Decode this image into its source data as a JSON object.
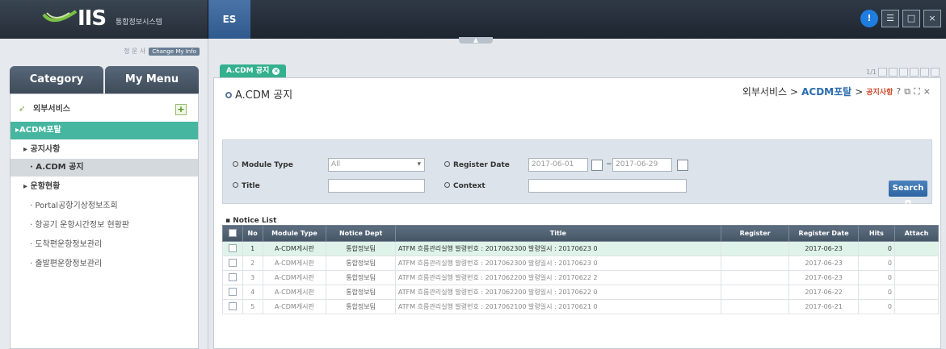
{
  "topbar": {
    "logo_text": "IIS",
    "logo_sub": "통합정보시스템",
    "system_tab": "ES",
    "icons": [
      "info-icon",
      "menu-icon",
      "window-icon",
      "close-icon"
    ]
  },
  "sidebar": {
    "user_text": "정 운 사",
    "change_info": "Change My Info",
    "tabs": [
      "Category",
      "My Menu"
    ],
    "root": "외부서비스",
    "items": [
      {
        "label": "ACDM포탈"
      },
      {
        "label": "공지사항"
      },
      {
        "label": "A.CDM 공지"
      },
      {
        "label": "운항현황"
      },
      {
        "label": "Portal공항기상정보조회"
      },
      {
        "label": "항공기 운항시간정보 현황판"
      },
      {
        "label": "도착편운항정보관리"
      },
      {
        "label": "출발편운항정보관리"
      }
    ]
  },
  "main": {
    "tab_label": "A.CDM 공지",
    "pager": "1/1",
    "title": "A.CDM 공지",
    "breadcrumb": {
      "c1": "외부서비스",
      "sep": ">",
      "c2": "ACDM포탈",
      "c3": "공지사항"
    },
    "search": {
      "module_type_label": "Module Type",
      "module_type_value": "All",
      "register_date_label": "Register Date",
      "date_from": "2017-06-01",
      "date_sep": "~",
      "date_to": "2017-06-29",
      "title_label": "Title",
      "context_label": "Context",
      "search_button": "Search"
    },
    "list_label": "Notice List",
    "table": {
      "headers": [
        "No",
        "Module Type",
        "Notice Dept",
        "Title",
        "Register",
        "Register Date",
        "Hits",
        "Attach"
      ],
      "rows": [
        {
          "no": "1",
          "module": "A-CDM게시판",
          "dept": "통합정보팀",
          "title": "ATFM 흐름관리실행 발령번호 : 2017062300 발령일시 : 20170623 0",
          "register": "",
          "date": "2017-06-23",
          "hits": "0"
        },
        {
          "no": "2",
          "module": "A-CDM게시판",
          "dept": "통합정보팀",
          "title": "ATFM 흐름관리실행 발령번호 : 2017062300 발령일시 : 20170623 0",
          "register": "",
          "date": "2017-06-23",
          "hits": "0"
        },
        {
          "no": "3",
          "module": "A-CDM게시판",
          "dept": "통합정보팀",
          "title": "ATFM 흐름관리실행 발령번호 : 2017062200 발령일시 : 20170622 2",
          "register": "",
          "date": "2017-06-23",
          "hits": "0"
        },
        {
          "no": "4",
          "module": "A-CDM게시판",
          "dept": "통합정보팀",
          "title": "ATFM 흐름관리실행 발령번호 : 2017062200 발령일시 : 20170622 0",
          "register": "",
          "date": "2017-06-22",
          "hits": "0"
        },
        {
          "no": "5",
          "module": "A-CDM게시판",
          "dept": "통합정보팀",
          "title": "ATFM 흐름관리실행 발령번호 : 2017062100 발령일시 : 20170621 0",
          "register": "",
          "date": "2017-06-21",
          "hits": "0"
        }
      ]
    }
  },
  "colors": {
    "accent_green": "#34b08f",
    "header_dark": "#455566",
    "search_blue": "#2c64a1"
  }
}
